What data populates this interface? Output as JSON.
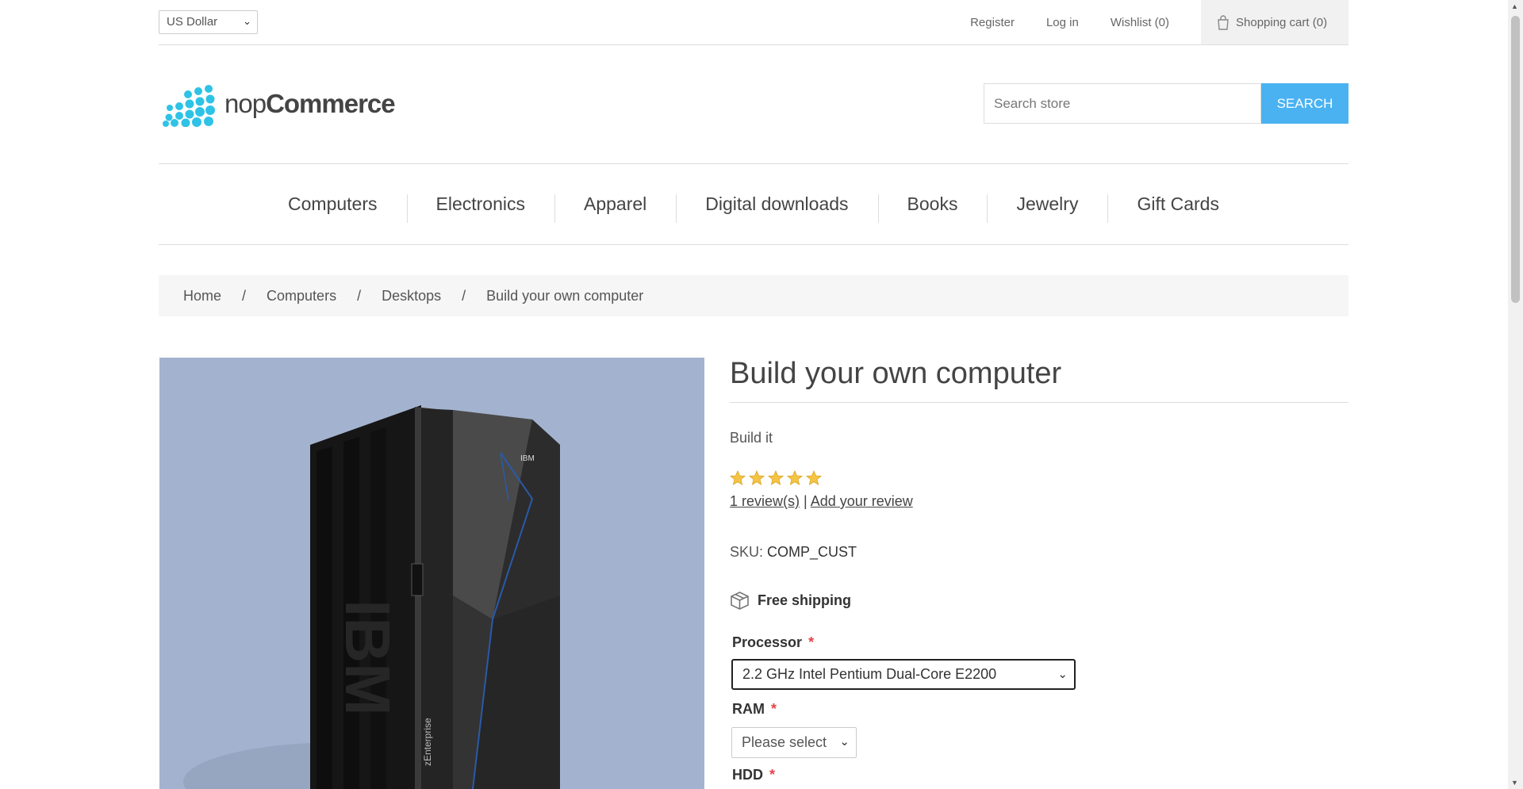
{
  "header": {
    "currency": "US Dollar",
    "links": {
      "register": "Register",
      "login": "Log in",
      "wishlist": "Wishlist (0)",
      "cart": "Shopping cart (0)"
    }
  },
  "logo": {
    "prefix": "nop",
    "suffix": "Commerce"
  },
  "search": {
    "placeholder": "Search store",
    "button": "SEARCH"
  },
  "menu": [
    "Computers",
    "Electronics",
    "Apparel",
    "Digital downloads",
    "Books",
    "Jewelry",
    "Gift Cards"
  ],
  "breadcrumb": {
    "items": [
      "Home",
      "Computers",
      "Desktops"
    ],
    "current": "Build your own computer",
    "separator": "/"
  },
  "product": {
    "title": "Build your own computer",
    "short_description": "Build it",
    "rating": 5,
    "rating_max": 5,
    "reviews_link": "1 review(s)",
    "reviews_sep": "|",
    "add_review_link": "Add your review",
    "sku_label": "SKU:",
    "sku_value": "COMP_CUST",
    "shipping": "Free shipping",
    "image_text": {
      "brand": "IBM",
      "model": "zEnterprise"
    },
    "attributes": [
      {
        "label": "Processor",
        "required": "*",
        "value": "2.2 GHz Intel Pentium Dual-Core E2200"
      },
      {
        "label": "RAM",
        "required": "*",
        "value": "Please select"
      },
      {
        "label": "HDD",
        "required": "*"
      }
    ]
  },
  "colors": {
    "accent": "#4ab2f1",
    "logo_dots": "#2ec3e6",
    "required": "#e4434b",
    "star": "#f5c445",
    "image_bg": "#a3b3cf"
  }
}
